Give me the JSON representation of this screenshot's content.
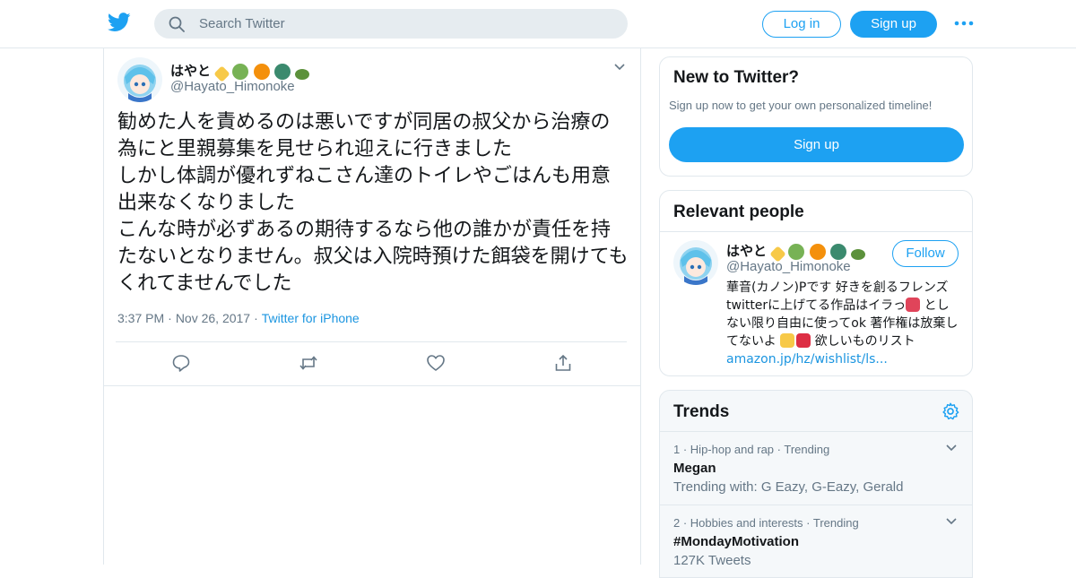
{
  "colors": {
    "accent": "#1da1f2",
    "link": "#1b95e0",
    "muted": "#657786",
    "text": "#14171a",
    "border": "#e1e8ed"
  },
  "header": {
    "logo_icon": "twitter-bird-icon",
    "search_placeholder": "Search Twitter",
    "login_label": "Log in",
    "signup_label": "Sign up",
    "more_icon": "more-dots-icon"
  },
  "tweet": {
    "display_name": "はやと",
    "name_emojis": [
      "sparkles",
      "dragon",
      "tiger-face",
      "peacock",
      "turtle"
    ],
    "handle": "@Hayato_Himonoke",
    "text": "勧めた人を責めるのは悪いですが同居の叔父から治療の為にと里親募集を見せられ迎えに行きました\nしかし体調が優れずねこさん達のトイレやごはんも用意出来なくなりました\nこんな時が必ずあるの期待するなら他の誰かが責任を持たないとなりません。叔父は入院時預けた餌袋を開けてもくれてませんでした",
    "time": "3:37 PM",
    "date": "Nov 26, 2017",
    "source": "Twitter for iPhone",
    "sep": "·",
    "actions": [
      "reply-icon",
      "retweet-icon",
      "like-icon",
      "share-icon"
    ]
  },
  "new_to_twitter": {
    "title": "New to Twitter?",
    "subtitle": "Sign up now to get your own personalized timeline!",
    "button": "Sign up"
  },
  "relevant_people": {
    "title": "Relevant people",
    "display_name": "はやと",
    "handle": "@Hayato_Himonoke",
    "follow_label": "Follow",
    "bio_1": "華音(カノン)Pです 好きを創るフレンズ twitterに上げてる作品はイラっ",
    "bio_2": "としない限り自由に使ってok 著作権は放棄してないよ ",
    "bio_3": "欲しいものリスト ",
    "bio_link": "amazon.jp/hz/wishlist/ls..."
  },
  "trends": {
    "title": "Trends",
    "items": [
      {
        "rank": "1",
        "category": "Hip-hop and rap",
        "status": "Trending",
        "name": "Megan",
        "extra": "Trending with: G Eazy, G-Eazy, Gerald"
      },
      {
        "rank": "2",
        "category": "Hobbies and interests",
        "status": "Trending",
        "name": "#MondayMotivation",
        "extra": "127K Tweets"
      }
    ]
  }
}
